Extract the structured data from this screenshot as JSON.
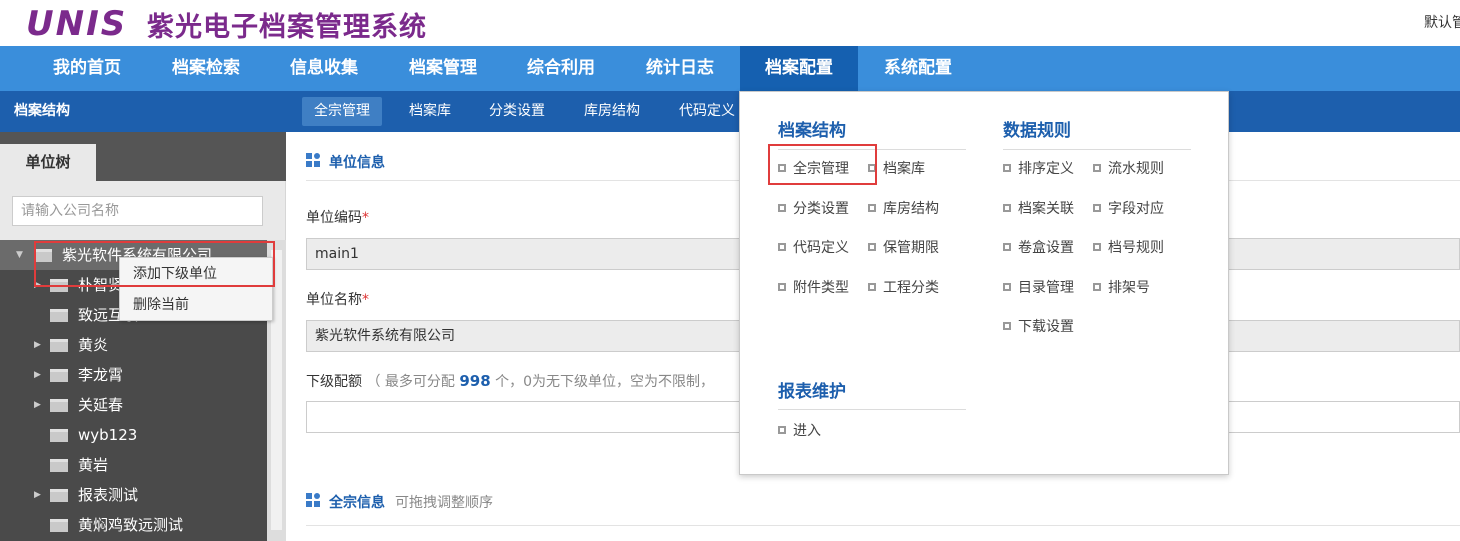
{
  "header": {
    "logo": "UNIS",
    "title": "紫光电子档案管理系统",
    "user_text": "默认管"
  },
  "main_nav": [
    "我的首页",
    "档案检索",
    "信息收集",
    "档案管理",
    "综合利用",
    "统计日志",
    "档案配置",
    "系统配置"
  ],
  "sub_nav": {
    "title": "档案结构",
    "items": [
      "全宗管理",
      "档案库",
      "分类设置",
      "库房结构",
      "代码定义"
    ]
  },
  "sidebar": {
    "tab": "单位树",
    "search_placeholder": "请输入公司名称",
    "tree": [
      "紫光软件系统有限公司",
      "朴智贤",
      "致远互联",
      "黄炎",
      "李龙霄",
      "关延春",
      "wyb123",
      "黄岩",
      "报表测试",
      "黄焖鸡致远测试"
    ]
  },
  "context_menu": [
    "添加下级单位",
    "删除当前"
  ],
  "content": {
    "unit_info_title": "单位信息",
    "unit_code_label": "单位编码",
    "unit_code_value": "main1",
    "unit_name_label": "单位名称",
    "unit_name_value": "紫光软件系统有限公司",
    "quota_label": "下级配额",
    "quota_hint_prefix": "（ 最多可分配",
    "quota_hint_number": "998",
    "quota_hint_suffix": "个，0为无下级单位，空为不限制，",
    "all_info_title": "全宗信息",
    "all_info_sub": "可拖拽调整顺序"
  },
  "dropdown": {
    "archive_structure": {
      "heading": "档案结构",
      "items": [
        "全宗管理",
        "档案库",
        "分类设置",
        "库房结构",
        "代码定义",
        "保管期限",
        "附件类型",
        "工程分类"
      ]
    },
    "data_rules": {
      "heading": "数据规则",
      "items": [
        "排序定义",
        "流水规则",
        "档案关联",
        "字段对应",
        "卷盒设置",
        "档号规则",
        "目录管理",
        "排架号",
        "下载设置"
      ]
    },
    "report": {
      "heading": "报表维护",
      "items": [
        "进入"
      ]
    }
  },
  "colors": {
    "brand": "#7b2a8c",
    "nav_bg": "#3a8edb",
    "nav_active": "#1560b0",
    "sub_nav_bg": "#1d5fad",
    "highlight": "#e03c3c"
  }
}
